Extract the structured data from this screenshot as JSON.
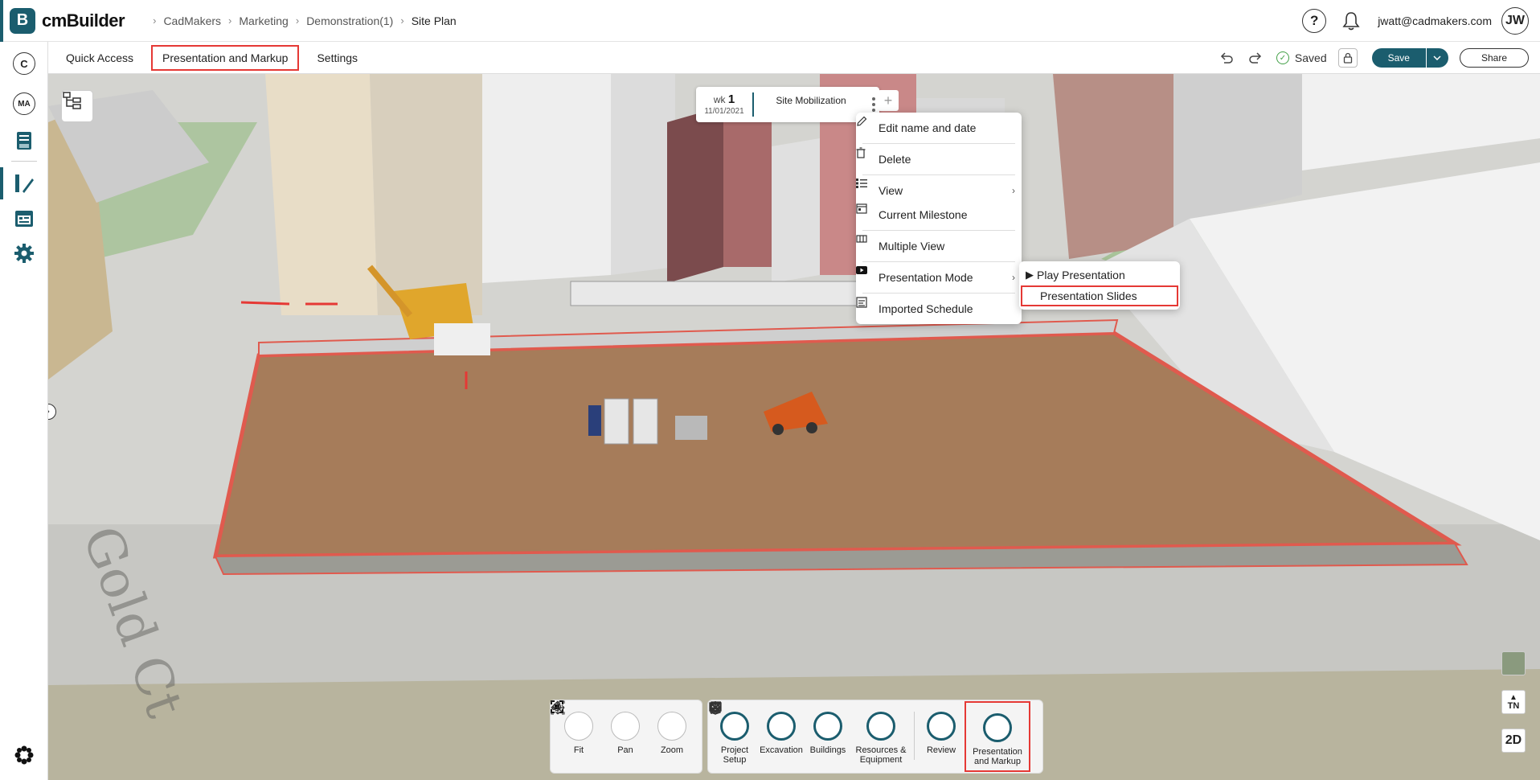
{
  "app": {
    "logo_letter": "B",
    "name": "cmBuilder"
  },
  "breadcrumbs": [
    "CadMakers",
    "Marketing",
    "Demonstration(1)",
    "Site Plan"
  ],
  "header": {
    "help": "?",
    "user_email": "jwatt@cadmakers.com",
    "user_initials": "JW"
  },
  "sidebar": {
    "company_initial": "C",
    "project_initials": "MA"
  },
  "subbar": {
    "tabs": [
      "Quick Access",
      "Presentation and Markup",
      "Settings"
    ],
    "saved_label": "Saved",
    "save_label": "Save",
    "share_label": "Share"
  },
  "milestone": {
    "week_prefix": "wk",
    "week_number": "1",
    "date": "11/01/2021",
    "name": "Site Mobilization",
    "add": "+"
  },
  "context_menu": {
    "items": [
      "Edit name and date",
      "Delete",
      "View",
      "Current Milestone",
      "Multiple View",
      "Presentation Mode",
      "Imported Schedule"
    ]
  },
  "submenu": {
    "items": [
      "Play Presentation",
      "Presentation Slides"
    ]
  },
  "bottom_tools": {
    "view": [
      "Fit",
      "Pan",
      "Zoom"
    ],
    "model": [
      "Project Setup",
      "Excavation",
      "Buildings",
      "Resources & Equipment",
      "Review",
      "Presentation and Markup"
    ]
  },
  "right_controls": {
    "north": "TN",
    "mode": "2D"
  },
  "colors": {
    "brand": "#1b5d6e",
    "highlight": "#e53935",
    "site_ground": "#a67c5a"
  }
}
